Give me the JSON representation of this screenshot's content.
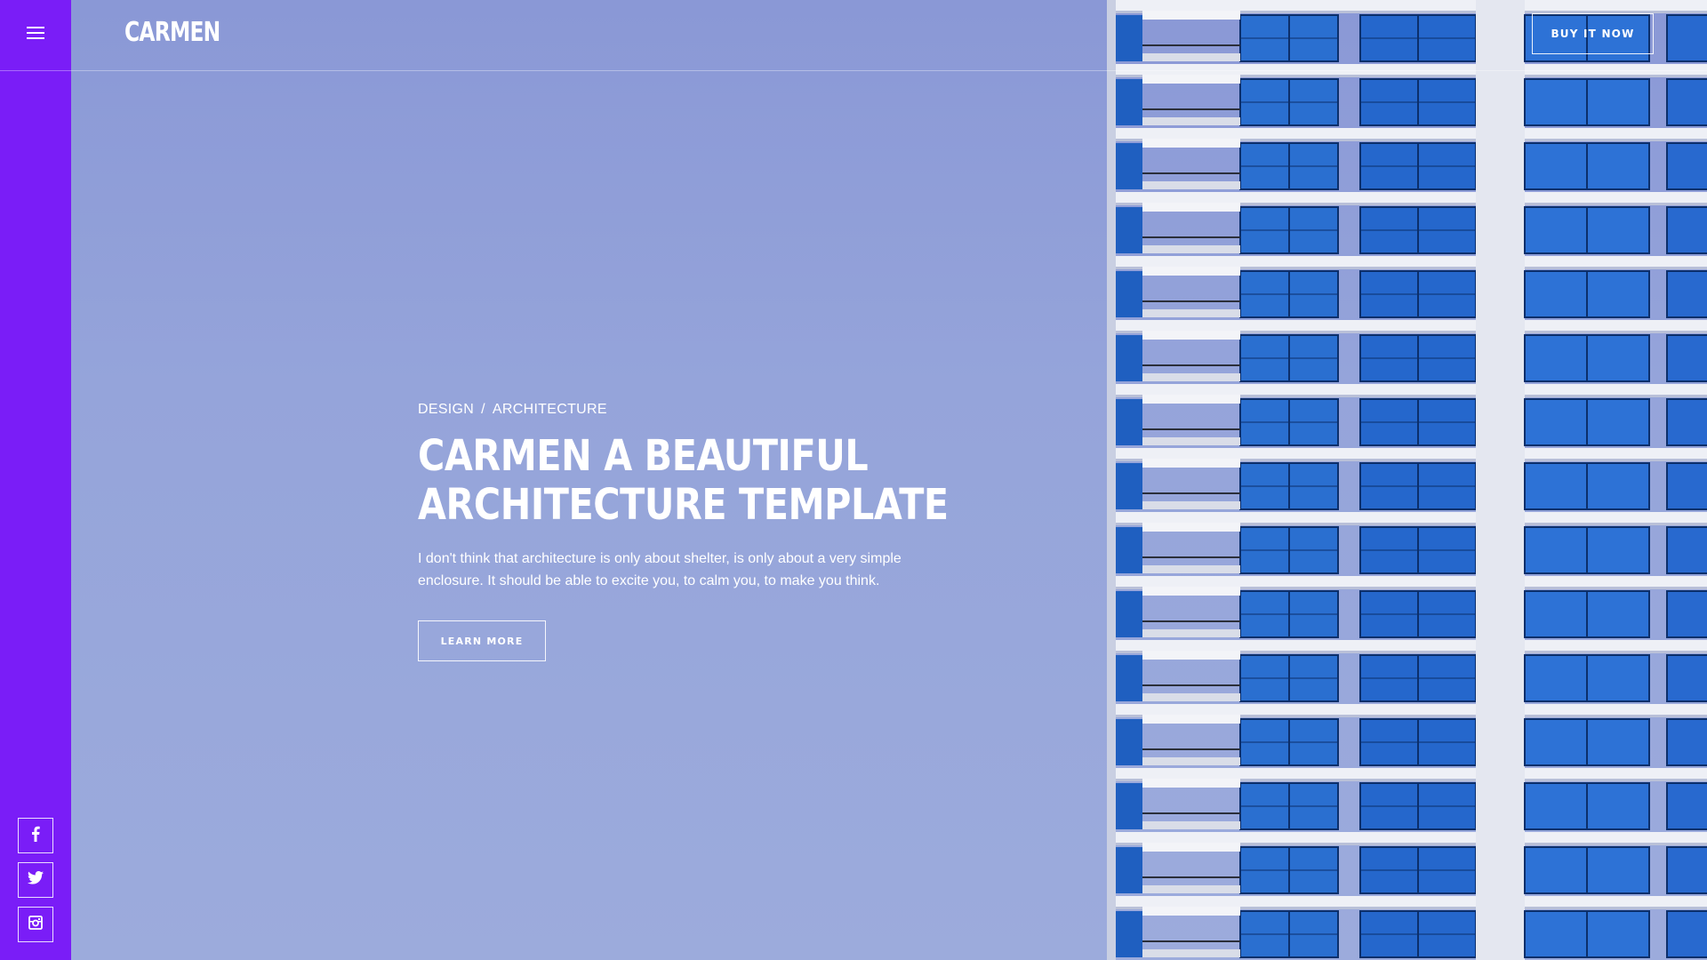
{
  "brand": {
    "logo_text": "CARMEN"
  },
  "header": {
    "buy_label": "BUY IT NOW"
  },
  "sidebar": {
    "menu_icon": "hamburger-icon",
    "social": [
      {
        "name": "facebook",
        "icon": "facebook-icon"
      },
      {
        "name": "twitter",
        "icon": "twitter-icon"
      },
      {
        "name": "instagram",
        "icon": "instagram-icon"
      }
    ]
  },
  "hero": {
    "category_1": "DESIGN",
    "separator": "/",
    "category_2": "ARCHITECTURE",
    "title_line_1": "CARMEN A BEAUTIFUL",
    "title_line_2": "ARCHITECTURE TEMPLATE",
    "description_line_1": "I don't think that architecture is only about shelter, is only about a very simple",
    "description_line_2": "enclosure. It should be able to excite you, to calm you, to make you think.",
    "button_label": "LEARN MORE"
  },
  "colors": {
    "sidebar": "#7a1df7",
    "sky": "#93a2d8",
    "text": "#ffffff",
    "glass": "#1f5fc0"
  }
}
